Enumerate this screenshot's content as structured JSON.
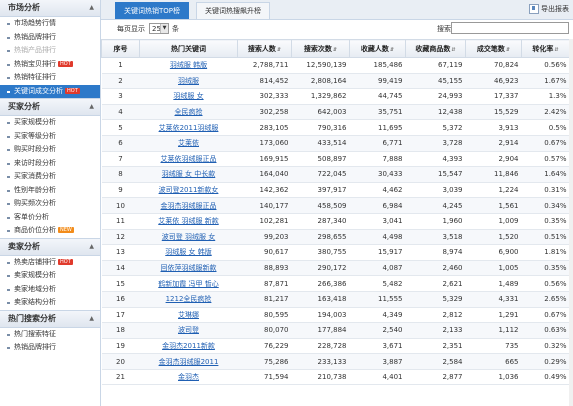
{
  "sidebar": {
    "sections": [
      {
        "title": "市场分析",
        "items": [
          {
            "label": "市场趋势行情",
            "state": "normal"
          },
          {
            "label": "热销品牌排行",
            "state": "normal"
          },
          {
            "label": "热销产品排行",
            "state": "disabled"
          },
          {
            "label": "热销宝贝排行",
            "state": "normal",
            "badge": "HOT"
          },
          {
            "label": "热销特征排行",
            "state": "normal"
          },
          {
            "label": "关键词成交分析",
            "state": "active",
            "badge": "HOT"
          }
        ]
      },
      {
        "title": "买家分析",
        "items": [
          {
            "label": "买家规模分析",
            "state": "normal"
          },
          {
            "label": "买家等级分析",
            "state": "normal"
          },
          {
            "label": "购买时段分析",
            "state": "normal"
          },
          {
            "label": "来访时段分析",
            "state": "normal"
          },
          {
            "label": "买家消费分析",
            "state": "normal"
          },
          {
            "label": "性别年龄分析",
            "state": "normal"
          },
          {
            "label": "购买频次分析",
            "state": "normal"
          },
          {
            "label": "客单价分析",
            "state": "normal"
          },
          {
            "label": "商品价位分析",
            "state": "normal",
            "badge": "NEW"
          }
        ]
      },
      {
        "title": "卖家分析",
        "items": [
          {
            "label": "热卖店铺排行",
            "state": "normal",
            "badge": "HOT"
          },
          {
            "label": "卖家规模分析",
            "state": "normal"
          },
          {
            "label": "卖家地域分析",
            "state": "normal"
          },
          {
            "label": "卖家结构分析",
            "state": "normal"
          }
        ]
      },
      {
        "title": "热门搜索分析",
        "items": [
          {
            "label": "热门搜索特征",
            "state": "normal"
          },
          {
            "label": "热销品牌排行",
            "state": "normal"
          }
        ]
      }
    ]
  },
  "tabs": [
    {
      "label": "关键词热销TOP榜",
      "active": true
    },
    {
      "label": "关键词热搜飙升榜",
      "active": false
    }
  ],
  "export_label": "导出报表",
  "toolbar": {
    "per_page_label": "每页显示",
    "per_page_value": "25",
    "per_page_unit": "条",
    "search_label": "搜索:"
  },
  "table": {
    "columns": [
      "序号",
      "热门关键词",
      "搜索人数",
      "搜索次数",
      "收藏人数",
      "收藏商品数",
      "成交笔数",
      "转化率"
    ],
    "rows": [
      [
        "1",
        "羽绒服 韩版",
        "2,788,711",
        "12,590,139",
        "185,486",
        "67,119",
        "70,824",
        "0.56%"
      ],
      [
        "2",
        "羽绒服",
        "814,452",
        "2,808,164",
        "99,419",
        "45,155",
        "46,923",
        "1.67%"
      ],
      [
        "3",
        "羽绒服 女",
        "302,333",
        "1,329,862",
        "44,745",
        "24,993",
        "17,337",
        "1.3%"
      ],
      [
        "4",
        "全民疯抢",
        "302,258",
        "642,003",
        "35,751",
        "12,438",
        "15,529",
        "2.42%"
      ],
      [
        "5",
        "艾莱依2011羽绒服",
        "283,105",
        "790,316",
        "11,695",
        "5,372",
        "3,913",
        "0.5%"
      ],
      [
        "6",
        "艾莱依",
        "173,060",
        "433,514",
        "6,771",
        "3,728",
        "2,914",
        "0.67%"
      ],
      [
        "7",
        "艾莱依羽绒服正品",
        "169,915",
        "508,897",
        "7,888",
        "4,393",
        "2,904",
        "0.57%"
      ],
      [
        "8",
        "羽绒服 女 中长款",
        "164,040",
        "722,045",
        "30,433",
        "15,547",
        "11,846",
        "1.64%"
      ],
      [
        "9",
        "波司登2011新款女",
        "142,362",
        "397,917",
        "4,462",
        "3,039",
        "1,224",
        "0.31%"
      ],
      [
        "10",
        "金羽杰羽绒服正品",
        "140,177",
        "458,509",
        "6,984",
        "4,245",
        "1,561",
        "0.34%"
      ],
      [
        "11",
        "艾莱依 羽绒服 新款",
        "102,281",
        "287,340",
        "3,041",
        "1,960",
        "1,009",
        "0.35%"
      ],
      [
        "12",
        "波司登 羽绒服 女",
        "99,203",
        "298,655",
        "4,498",
        "3,518",
        "1,520",
        "0.51%"
      ],
      [
        "13",
        "羽绒服 女 韩版",
        "90,617",
        "380,755",
        "15,917",
        "8,974",
        "6,900",
        "1.81%"
      ],
      [
        "14",
        "回依萍羽绒服新款",
        "88,893",
        "290,172",
        "4,087",
        "2,460",
        "1,005",
        "0.35%"
      ],
      [
        "15",
        "鹤新加霞 冯甲 皙心",
        "87,871",
        "266,386",
        "5,482",
        "2,621",
        "1,489",
        "0.56%"
      ],
      [
        "16",
        "1212全民疯抢",
        "81,217",
        "163,418",
        "11,555",
        "5,329",
        "4,331",
        "2.65%"
      ],
      [
        "17",
        "艾琳娜",
        "80,595",
        "194,003",
        "4,349",
        "2,812",
        "1,291",
        "0.67%"
      ],
      [
        "18",
        "波司登",
        "80,070",
        "177,884",
        "2,540",
        "2,133",
        "1,112",
        "0.63%"
      ],
      [
        "19",
        "金羽杰2011新款",
        "76,229",
        "228,728",
        "3,671",
        "2,351",
        "735",
        "0.32%"
      ],
      [
        "20",
        "金羽杰羽绒服2011",
        "75,286",
        "233,133",
        "3,887",
        "2,584",
        "665",
        "0.29%"
      ],
      [
        "21",
        "金羽杰",
        "71,594",
        "210,738",
        "4,401",
        "2,877",
        "1,036",
        "0.49%"
      ]
    ]
  }
}
